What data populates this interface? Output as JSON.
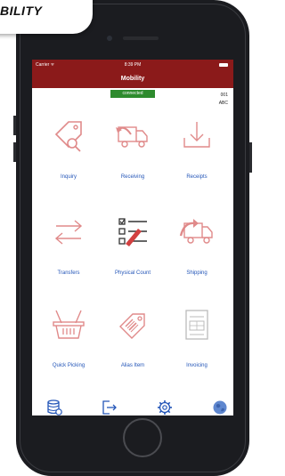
{
  "badge": {
    "text": "BILITY"
  },
  "status_bar": {
    "carrier": "Carrier ᯤ",
    "time": "8:39 PM"
  },
  "header": {
    "title": "Mobility"
  },
  "connection": {
    "status": "connected"
  },
  "info": {
    "line1": "001",
    "line2": "ABC"
  },
  "menu": [
    {
      "label": "Inquiry",
      "icon": "tag-search-icon"
    },
    {
      "label": "Receiving",
      "icon": "truck-return-icon"
    },
    {
      "label": "Receipts",
      "icon": "tray-download-icon"
    },
    {
      "label": "Transfers",
      "icon": "transfer-arrows-icon"
    },
    {
      "label": "Physical Count",
      "icon": "checklist-icon"
    },
    {
      "label": "Shipping",
      "icon": "truck-forward-icon"
    },
    {
      "label": "Quick Picking",
      "icon": "basket-icon"
    },
    {
      "label": "Alias Item",
      "icon": "barcode-tag-icon"
    },
    {
      "label": "Invoicing",
      "icon": "invoice-icon"
    }
  ],
  "toolbar": [
    {
      "icon": "database-icon"
    },
    {
      "icon": "logout-icon"
    },
    {
      "icon": "settings-gear-icon"
    },
    {
      "icon": "globe-icon"
    }
  ],
  "colors": {
    "header": "#8b1a1a",
    "connected": "#2e8b2e",
    "label": "#2456b8",
    "icon": "#e08a8a"
  }
}
